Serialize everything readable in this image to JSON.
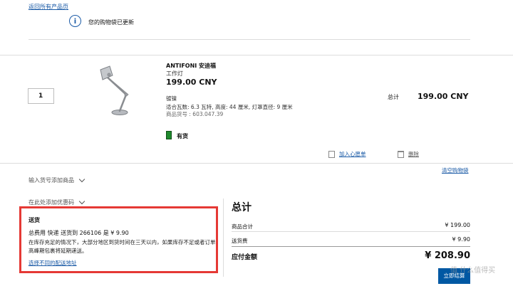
{
  "nav": {
    "back_link": "返回所有产品页"
  },
  "notice": {
    "icon": "info-icon",
    "text": "您的购物袋已更新"
  },
  "item": {
    "quantity": "1",
    "name": "ANTIFONI 安迪福",
    "type": "工作灯",
    "price": "199.00 CNY",
    "color": "镀镍",
    "spec": "适合瓦数: 6.3 瓦特, 高度: 44 厘米, 灯罩直径: 9 厘米",
    "article_no": "商品货号 : 603.047.39",
    "stock": "有货",
    "subtotal_label": "总计",
    "subtotal_value": "199.00 CNY",
    "add_favorite": "加入心愿单",
    "delete": "删除"
  },
  "cart": {
    "clear_link": "清空购物袋"
  },
  "options": {
    "add_by_article": "输入货号添加商品",
    "coupon": "在此处添加优惠码"
  },
  "delivery": {
    "title": "送货",
    "line1": "总费用 快递 送货到 266106 是 ¥ 9.90",
    "line2": "在库存充足的情况下，大部分地区到货时间在三天以内，如果库存不足或者订单高峰期包裹将延期递送。",
    "change_link": "选择不同的配送地址"
  },
  "summary": {
    "title": "总计",
    "goods_label": "商品合计",
    "goods_value": "¥ 199.00",
    "shipping_label": "送货费",
    "shipping_value": "¥ 9.90",
    "total_label": "应付金额",
    "total_value": "¥ 208.90",
    "checkout": "立即结算"
  },
  "watermark": "值 什么值得买",
  "colors": {
    "accent": "#0058a3",
    "link": "#1a5aa6",
    "highlight_border": "#e53935",
    "stock": "#1f8a2e"
  }
}
